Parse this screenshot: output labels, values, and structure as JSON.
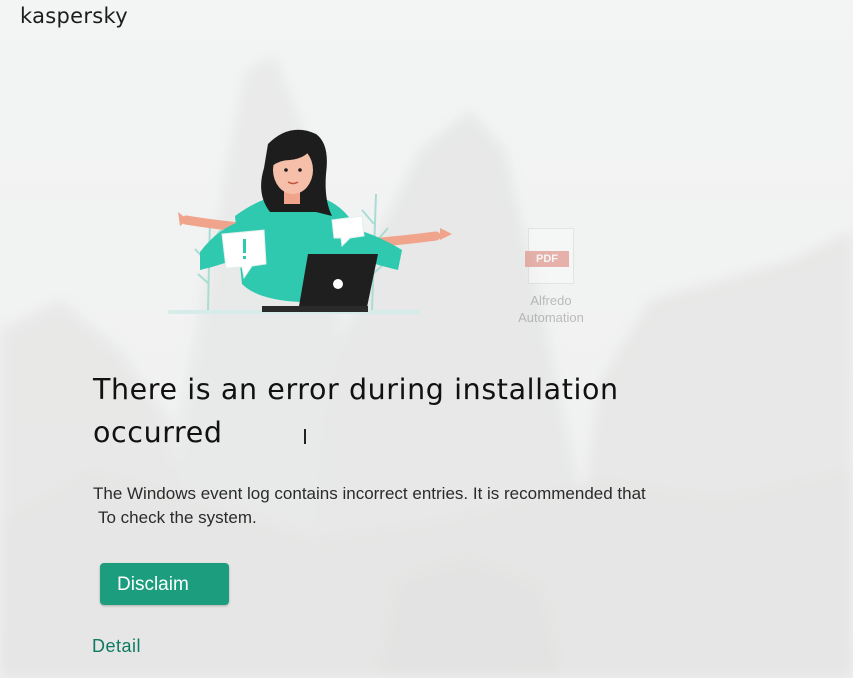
{
  "app": {
    "brand": "kaspersky"
  },
  "background": {
    "desktop_icon": {
      "name": "pdf-file-icon",
      "badge": "PDF",
      "caption": "Alfredo\nAutomation"
    }
  },
  "illustration": {
    "name": "confused-woman-laptop-illustration"
  },
  "message": {
    "title": "There is an error during installation occurred",
    "description_line1": "The Windows event log contains incorrect entries. It is recommended that",
    "description_line2": "To check the system."
  },
  "actions": {
    "primary_label": "Disclaim",
    "detail_link": "Detail"
  },
  "colors": {
    "accent": "#1c9e7e",
    "link": "#0f7a63",
    "illustration_teal": "#2ec9ae",
    "text": "#1d1d1b"
  }
}
